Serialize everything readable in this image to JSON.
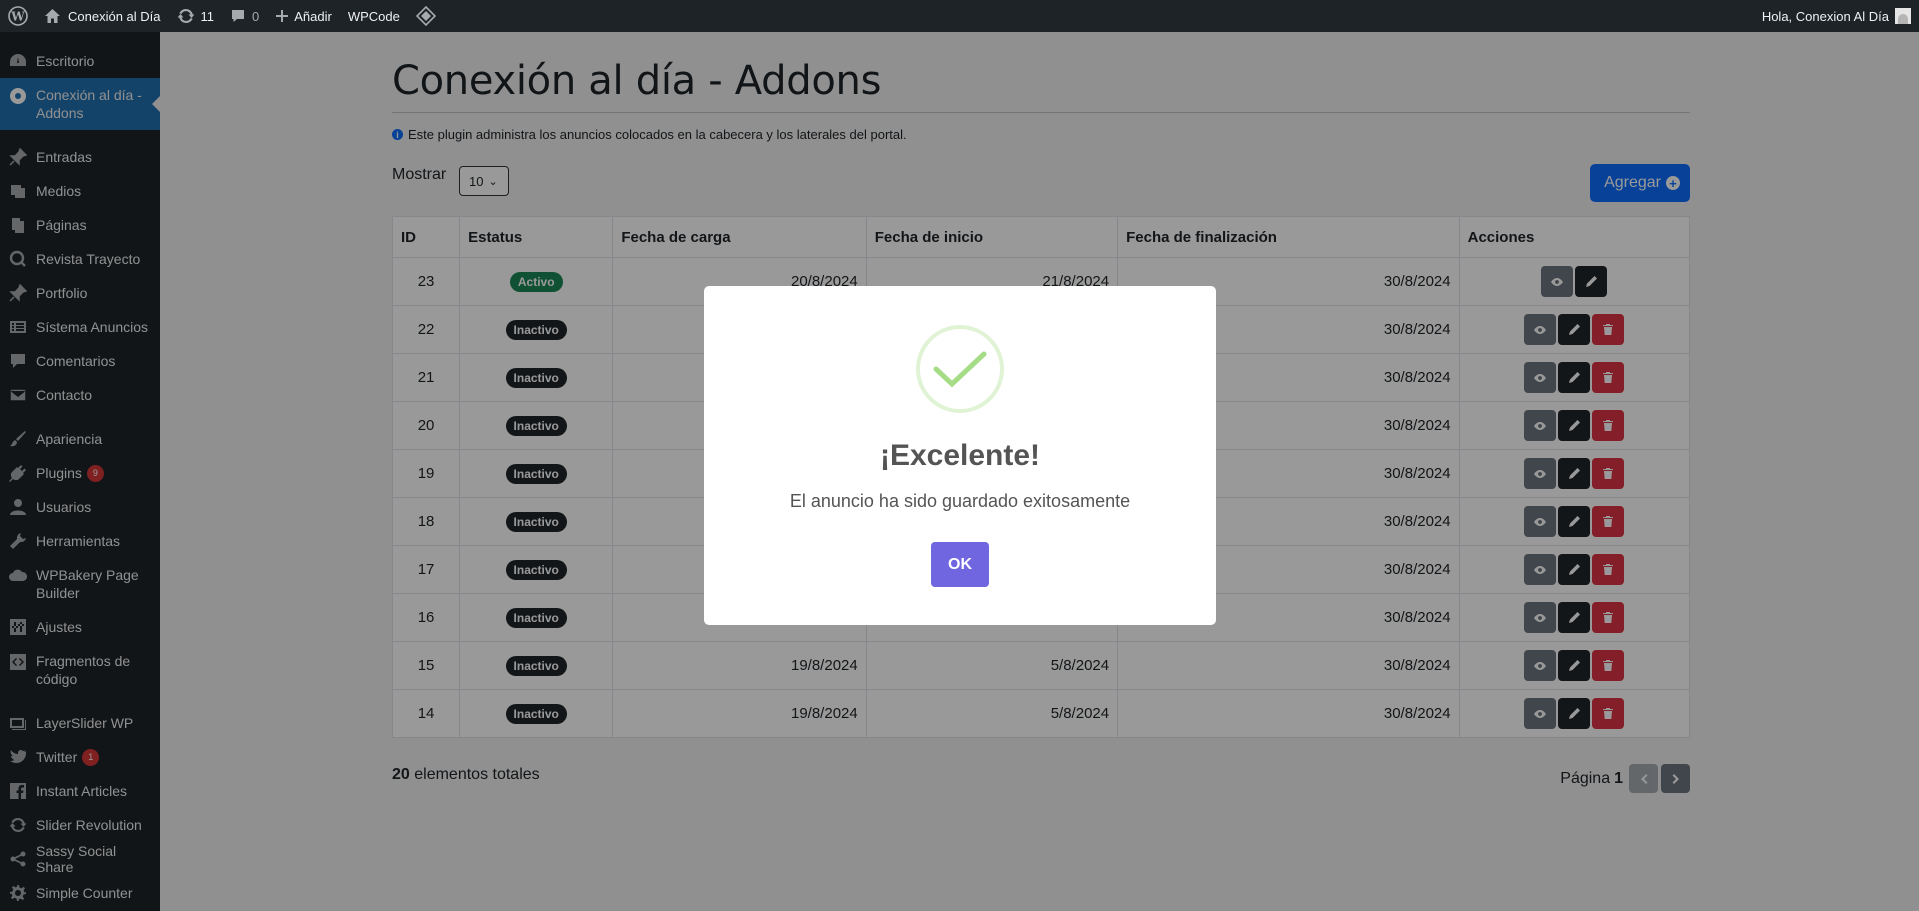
{
  "admin_bar": {
    "site_name": "Conexión al Día",
    "updates_count": "11",
    "comments_count": "0",
    "add_new_label": "Añadir",
    "wpcode_label": "WPCode",
    "greeting": "Hola, Conexion Al Día"
  },
  "sidebar": {
    "items": [
      {
        "label": "Escritorio",
        "icon": "dashboard-icon"
      },
      {
        "label": "Conexión al día - Addons",
        "icon": "plugin-custom-icon",
        "current": true
      },
      {
        "label": "Entradas",
        "icon": "pin-icon"
      },
      {
        "label": "Medios",
        "icon": "media-icon"
      },
      {
        "label": "Páginas",
        "icon": "pages-icon"
      },
      {
        "label": "Revista Trayecto",
        "icon": "search-icon"
      },
      {
        "label": "Portfolio",
        "icon": "pin-icon"
      },
      {
        "label": "Sístema Anuncios",
        "icon": "list-icon"
      },
      {
        "label": "Comentarios",
        "icon": "comment-icon"
      },
      {
        "label": "Contacto",
        "icon": "mail-icon"
      },
      {
        "label": "Apariencia",
        "icon": "brush-icon"
      },
      {
        "label": "Plugins",
        "icon": "plugin-icon",
        "badge": "9"
      },
      {
        "label": "Usuarios",
        "icon": "user-icon"
      },
      {
        "label": "Herramientas",
        "icon": "wrench-icon"
      },
      {
        "label": "WPBakery Page Builder",
        "icon": "cloud-icon"
      },
      {
        "label": "Ajustes",
        "icon": "settings-icon"
      },
      {
        "label": "Fragmentos de código",
        "icon": "code-icon"
      },
      {
        "label": "LayerSlider WP",
        "icon": "layers-icon"
      },
      {
        "label": "Twitter",
        "icon": "twitter-icon",
        "badge": "1"
      },
      {
        "label": "Instant Articles",
        "icon": "facebook-icon"
      },
      {
        "label": "Slider Revolution",
        "icon": "refresh-icon"
      },
      {
        "label": "Sassy Social Share",
        "icon": "share-icon"
      },
      {
        "label": "Simple Counter",
        "icon": "gear-icon"
      }
    ]
  },
  "page": {
    "title": "Conexión al día - Addons",
    "info": "Este plugin administra los anuncios colocados en la cabecera y los laterales del portal.",
    "show_label": "Mostrar",
    "show_value": "10",
    "add_button": "Agregar"
  },
  "table": {
    "headers": [
      "ID",
      "Estatus",
      "Fecha de carga",
      "Fecha de inicio",
      "Fecha de finalización",
      "Acciones"
    ],
    "rows": [
      {
        "id": "23",
        "status": "Activo",
        "carga": "20/8/2024",
        "inicio": "21/8/2024",
        "fin": "30/8/2024"
      },
      {
        "id": "22",
        "status": "Inactivo",
        "carga": "",
        "inicio": "",
        "fin": "30/8/2024"
      },
      {
        "id": "21",
        "status": "Inactivo",
        "carga": "",
        "inicio": "",
        "fin": "30/8/2024"
      },
      {
        "id": "20",
        "status": "Inactivo",
        "carga": "",
        "inicio": "",
        "fin": "30/8/2024"
      },
      {
        "id": "19",
        "status": "Inactivo",
        "carga": "",
        "inicio": "",
        "fin": "30/8/2024"
      },
      {
        "id": "18",
        "status": "Inactivo",
        "carga": "",
        "inicio": "",
        "fin": "30/8/2024"
      },
      {
        "id": "17",
        "status": "Inactivo",
        "carga": "",
        "inicio": "",
        "fin": "30/8/2024"
      },
      {
        "id": "16",
        "status": "Inactivo",
        "carga": "",
        "inicio": "",
        "fin": "30/8/2024"
      },
      {
        "id": "15",
        "status": "Inactivo",
        "carga": "19/8/2024",
        "inicio": "5/8/2024",
        "fin": "30/8/2024"
      },
      {
        "id": "14",
        "status": "Inactivo",
        "carga": "19/8/2024",
        "inicio": "5/8/2024",
        "fin": "30/8/2024"
      }
    ]
  },
  "footer": {
    "total_count": "20",
    "total_label": "elementos totales",
    "page_label": "Página",
    "page_current": "1"
  },
  "modal": {
    "title": "¡Excelente!",
    "text": "El anuncio ha sido guardado exitosamente",
    "ok_label": "OK"
  },
  "colors": {
    "accent": "#2271b1",
    "primary_button": "#0d6efd",
    "active_badge": "#198754",
    "danger": "#dc3545",
    "modal_ok": "#7066e0",
    "success_check": "#a5dc86"
  }
}
